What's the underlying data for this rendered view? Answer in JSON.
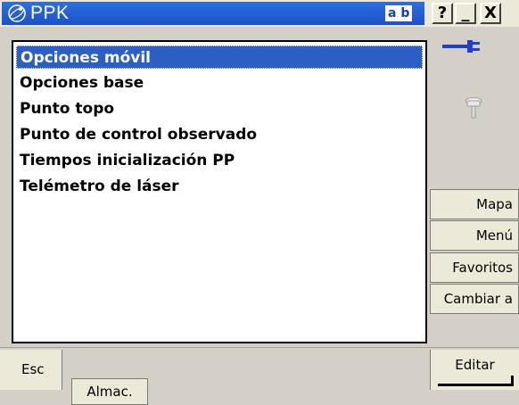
{
  "window": {
    "title": "PPK",
    "input_indicator": "a b",
    "help_label": "?",
    "minimize_label": "_",
    "close_label": "X"
  },
  "list": {
    "selected_index": 0,
    "items": [
      "Opciones móvil",
      "Opciones base",
      "Punto topo",
      "Punto de control observado",
      "Tiempos inicialización PP",
      "Telémetro de láser"
    ]
  },
  "status": {
    "power_icon": "power-plug-icon",
    "receiver_icon": "gnss-antenna-icon"
  },
  "side_buttons": [
    "Mapa",
    "Menú",
    "Favoritos",
    "Cambiar a"
  ],
  "bottom": {
    "esc_label": "Esc",
    "store_label": "Almac.",
    "edit_label": "Editar"
  },
  "colors": {
    "titlebar": "#1a52c8",
    "selection": "#2c5ec4",
    "panel": "#d4d0c8"
  }
}
